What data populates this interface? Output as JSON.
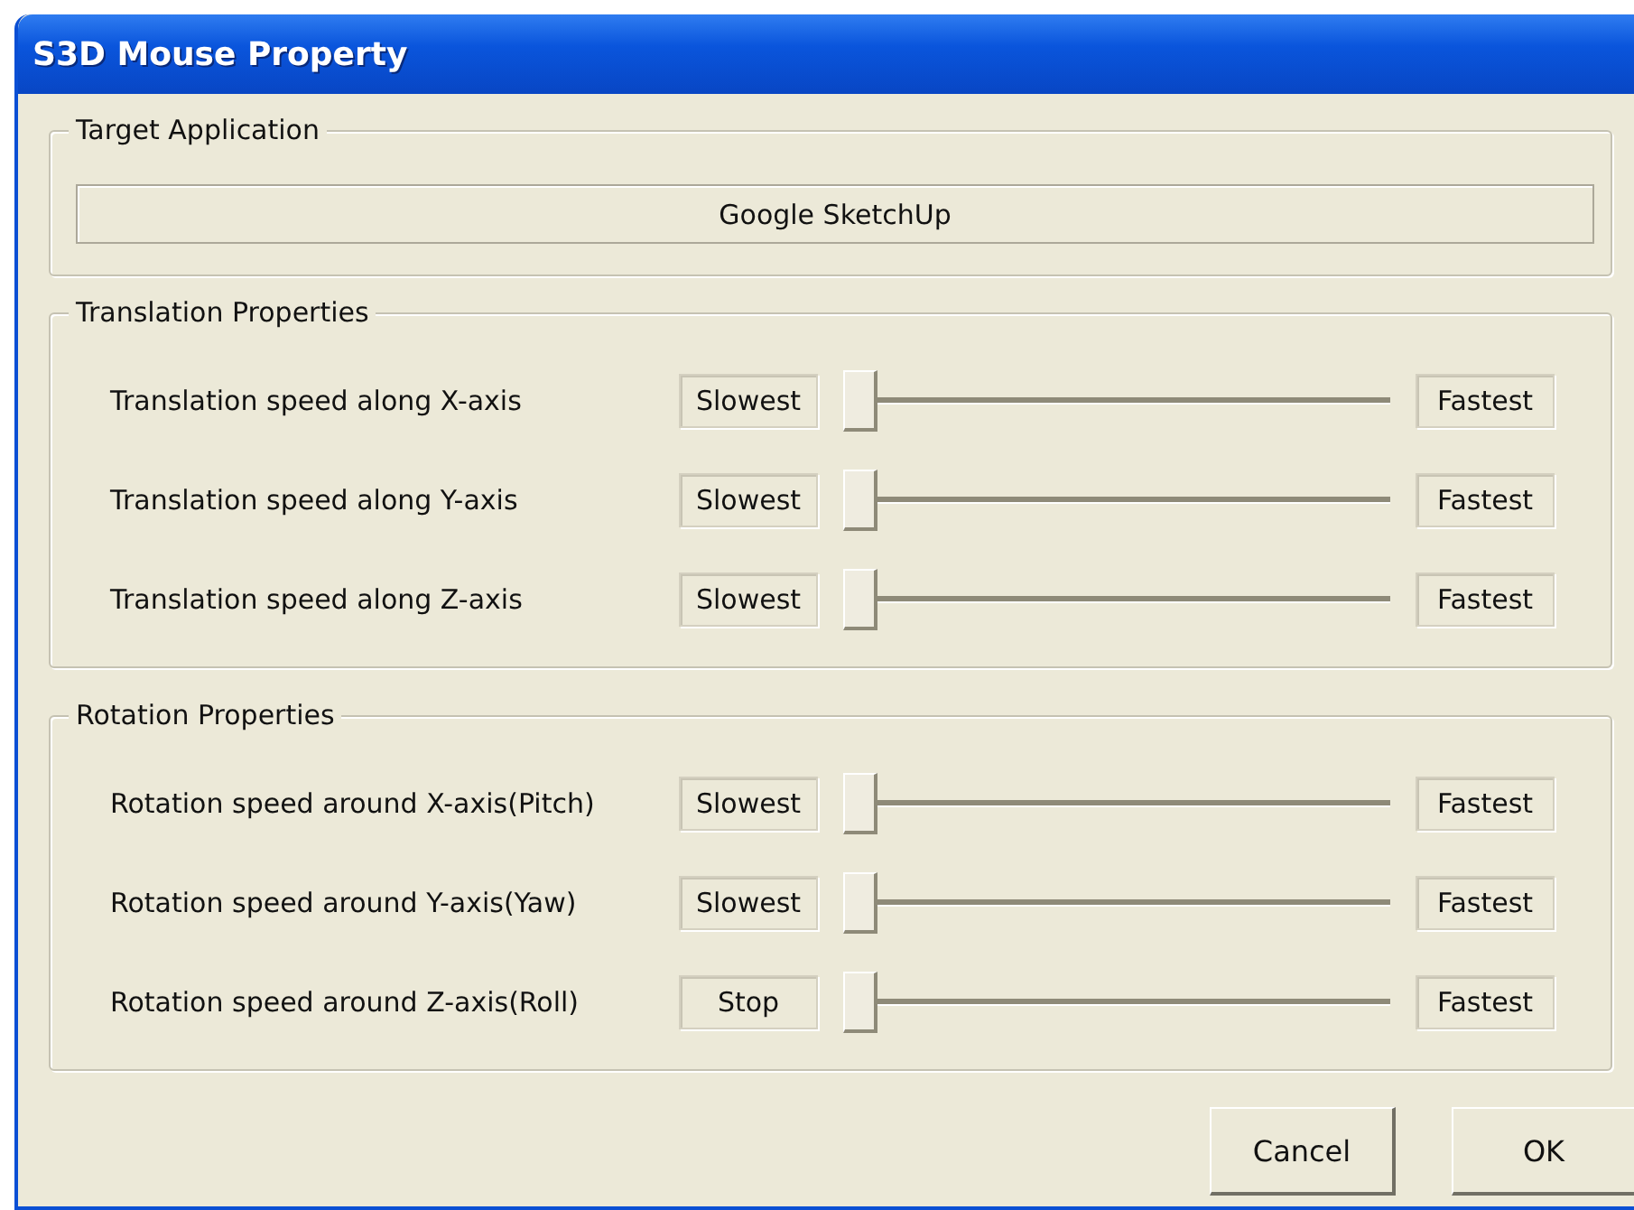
{
  "window": {
    "title": "S3D Mouse Property"
  },
  "target_application": {
    "title": "Target Application",
    "value": "Google SketchUp"
  },
  "groups": [
    {
      "title": "Translation Properties",
      "rows": [
        {
          "label": "Translation speed along X-axis",
          "min_label": "Slowest",
          "level": 0,
          "max_label": "Fastest"
        },
        {
          "label": "Translation speed along Y-axis",
          "min_label": "Slowest",
          "level": 0,
          "max_label": "Fastest"
        },
        {
          "label": "Translation speed along Z-axis",
          "min_label": "Slowest",
          "level": 0,
          "max_label": "Fastest"
        }
      ]
    },
    {
      "title": "Rotation Properties",
      "rows": [
        {
          "label": "Rotation speed around X-axis(Pitch)",
          "min_label": "Slowest",
          "level": 0,
          "max_label": "Fastest"
        },
        {
          "label": "Rotation speed around Y-axis(Yaw)",
          "min_label": "Slowest",
          "level": 0,
          "max_label": "Fastest"
        },
        {
          "label": "Rotation speed around Z-axis(Roll)",
          "min_label": "Stop",
          "level": 0,
          "max_label": "Fastest"
        }
      ]
    }
  ],
  "buttons": [
    "Cancel",
    "OK"
  ]
}
